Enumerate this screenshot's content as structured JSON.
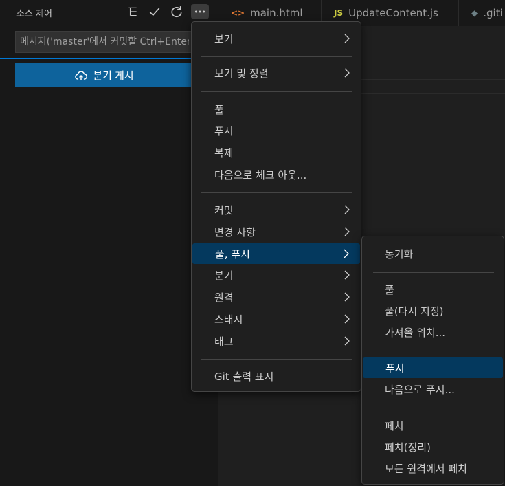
{
  "scm": {
    "title": "소스 제어",
    "commit_placeholder": "메시지('master'에서 커밋할 Ctrl+Enter)",
    "publish_label": "분기 게시"
  },
  "tabs": [
    {
      "label": "main.html",
      "icon": "<>",
      "icon_color": "#e37933"
    },
    {
      "label": "UpdateContent.js",
      "icon": "JS",
      "icon_color": "#cbcb41"
    },
    {
      "label": ".giti",
      "icon": "◆",
      "icon_color": "#6d8086"
    }
  ],
  "menu": {
    "view": "보기",
    "view_sort": "보기 및 정렬",
    "pull": "풀",
    "push": "푸시",
    "clone": "복제",
    "checkout": "다음으로 체크 아웃...",
    "commit": "커밋",
    "changes": "변경 사항",
    "pull_push": "풀, 푸시",
    "branch": "분기",
    "remote": "원격",
    "stash": "스태시",
    "tags": "태그",
    "show_git_output": "Git 출력 표시"
  },
  "submenu": {
    "sync": "동기화",
    "pull": "풀",
    "pull_rebase": "풀(다시 지정)",
    "pull_from": "가져올 위치...",
    "push": "푸시",
    "push_to": "다음으로 푸시...",
    "fetch": "페치",
    "fetch_prune": "페치(정리)",
    "fetch_all": "모든 원격에서 페치"
  },
  "colors": {
    "accent": "#0e639c",
    "active_menu": "#04395e",
    "focus_border": "#0078d4"
  }
}
